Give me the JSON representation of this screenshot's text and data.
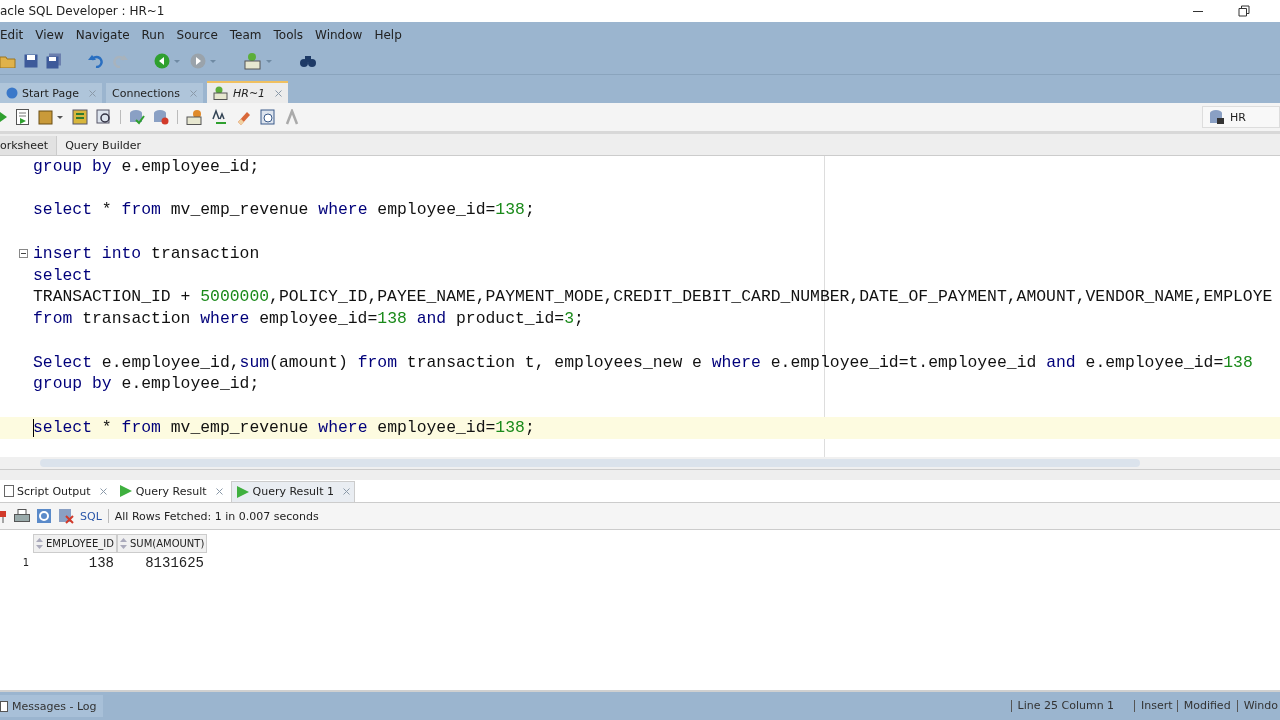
{
  "window": {
    "title": "acle SQL Developer : HR~1"
  },
  "menu": [
    "Edit",
    "View",
    "Navigate",
    "Run",
    "Source",
    "Team",
    "Tools",
    "Window",
    "Help"
  ],
  "doc_tabs": [
    {
      "label": "Start Page",
      "selected": false
    },
    {
      "label": "Connections",
      "selected": false
    },
    {
      "label": "HR~1",
      "selected": true
    }
  ],
  "connection": "HR",
  "editor_tabs": [
    {
      "label": "orksheet",
      "selected": true
    },
    {
      "label": "Query Builder",
      "selected": false
    }
  ],
  "code_lines": [
    {
      "current": false,
      "fold": false,
      "tokens": [
        {
          "kind": "kw",
          "t": "group by"
        },
        {
          "kind": "tx",
          "t": " e.employee_id;"
        }
      ]
    },
    {
      "current": false,
      "fold": false
    },
    {
      "current": false,
      "fold": false,
      "tokens": [
        {
          "kind": "kw",
          "t": "select"
        },
        {
          "kind": "tx",
          "t": " * "
        },
        {
          "kind": "kw",
          "t": "from"
        },
        {
          "kind": "tx",
          "t": " mv_emp_revenue "
        },
        {
          "kind": "kw",
          "t": "where"
        },
        {
          "kind": "tx",
          "t": " employee_id="
        },
        {
          "kind": "num",
          "t": "138"
        },
        {
          "kind": "tx",
          "t": ";"
        }
      ]
    },
    {
      "current": false,
      "fold": false
    },
    {
      "current": false,
      "fold": true,
      "tokens": [
        {
          "kind": "kw",
          "t": "insert into"
        },
        {
          "kind": "tx",
          "t": " transaction"
        }
      ]
    },
    {
      "current": false,
      "fold": false,
      "tokens": [
        {
          "kind": "kw",
          "t": "select"
        }
      ]
    },
    {
      "current": false,
      "fold": false,
      "tokens": [
        {
          "kind": "tx",
          "t": "TRANSACTION_ID + "
        },
        {
          "kind": "num",
          "t": "5000000"
        },
        {
          "kind": "tx",
          "t": ",POLICY_ID,PAYEE_NAME,PAYMENT_MODE,CREDIT_DEBIT_CARD_NUMBER,DATE_OF_PAYMENT,AMOUNT,VENDOR_NAME,EMPLOYE"
        }
      ]
    },
    {
      "current": false,
      "fold": false,
      "tokens": [
        {
          "kind": "kw",
          "t": "from"
        },
        {
          "kind": "tx",
          "t": " transaction "
        },
        {
          "kind": "kw",
          "t": "where"
        },
        {
          "kind": "tx",
          "t": " employee_id="
        },
        {
          "kind": "num",
          "t": "138"
        },
        {
          "kind": "kw",
          "t": " and"
        },
        {
          "kind": "tx",
          "t": " product_id="
        },
        {
          "kind": "num",
          "t": "3"
        },
        {
          "kind": "tx",
          "t": ";"
        }
      ]
    },
    {
      "current": false,
      "fold": false
    },
    {
      "current": false,
      "fold": false,
      "tokens": [
        {
          "kind": "kw",
          "t": "Select"
        },
        {
          "kind": "tx",
          "t": " e.employee_id,"
        },
        {
          "kind": "kw",
          "t": "sum"
        },
        {
          "kind": "tx",
          "t": "(amount) "
        },
        {
          "kind": "kw",
          "t": "from"
        },
        {
          "kind": "tx",
          "t": " transaction t, employees_new e "
        },
        {
          "kind": "kw",
          "t": "where"
        },
        {
          "kind": "tx",
          "t": " e.employee_id=t.employee_id "
        },
        {
          "kind": "kw",
          "t": "and"
        },
        {
          "kind": "tx",
          "t": " e.employee_id="
        },
        {
          "kind": "num",
          "t": "138"
        }
      ]
    },
    {
      "current": false,
      "fold": false,
      "tokens": [
        {
          "kind": "kw",
          "t": "group by"
        },
        {
          "kind": "tx",
          "t": " e.employee_id;"
        }
      ]
    },
    {
      "current": false,
      "fold": false
    },
    {
      "current": true,
      "fold": false,
      "tokens": [
        {
          "kind": "kw",
          "t": "select"
        },
        {
          "kind": "tx",
          "t": " * "
        },
        {
          "kind": "kw",
          "t": "from"
        },
        {
          "kind": "tx",
          "t": " mv_emp_revenue "
        },
        {
          "kind": "kw",
          "t": "where"
        },
        {
          "kind": "tx",
          "t": " employee_id="
        },
        {
          "kind": "num",
          "t": "138"
        },
        {
          "kind": "tx",
          "t": ";"
        }
      ]
    }
  ],
  "result_tabs": [
    {
      "label": "Script Output",
      "selected": false,
      "kind": "script"
    },
    {
      "label": "Query Result",
      "selected": false,
      "kind": "query"
    },
    {
      "label": "Query Result 1",
      "selected": true,
      "kind": "query"
    }
  ],
  "result_toolbar": {
    "sql_label": "SQL",
    "status": "All Rows Fetched: 1 in 0.007 seconds"
  },
  "table": {
    "columns": [
      "EMPLOYEE_ID",
      "SUM(AMOUNT)"
    ],
    "rows": [
      {
        "number": "1",
        "cells": [
          "138",
          "8131625"
        ]
      }
    ]
  },
  "status_bar": {
    "left": "Messages - Log",
    "items": [
      "Line 25 Column 1",
      "Insert",
      "Modified",
      "Windo"
    ]
  }
}
